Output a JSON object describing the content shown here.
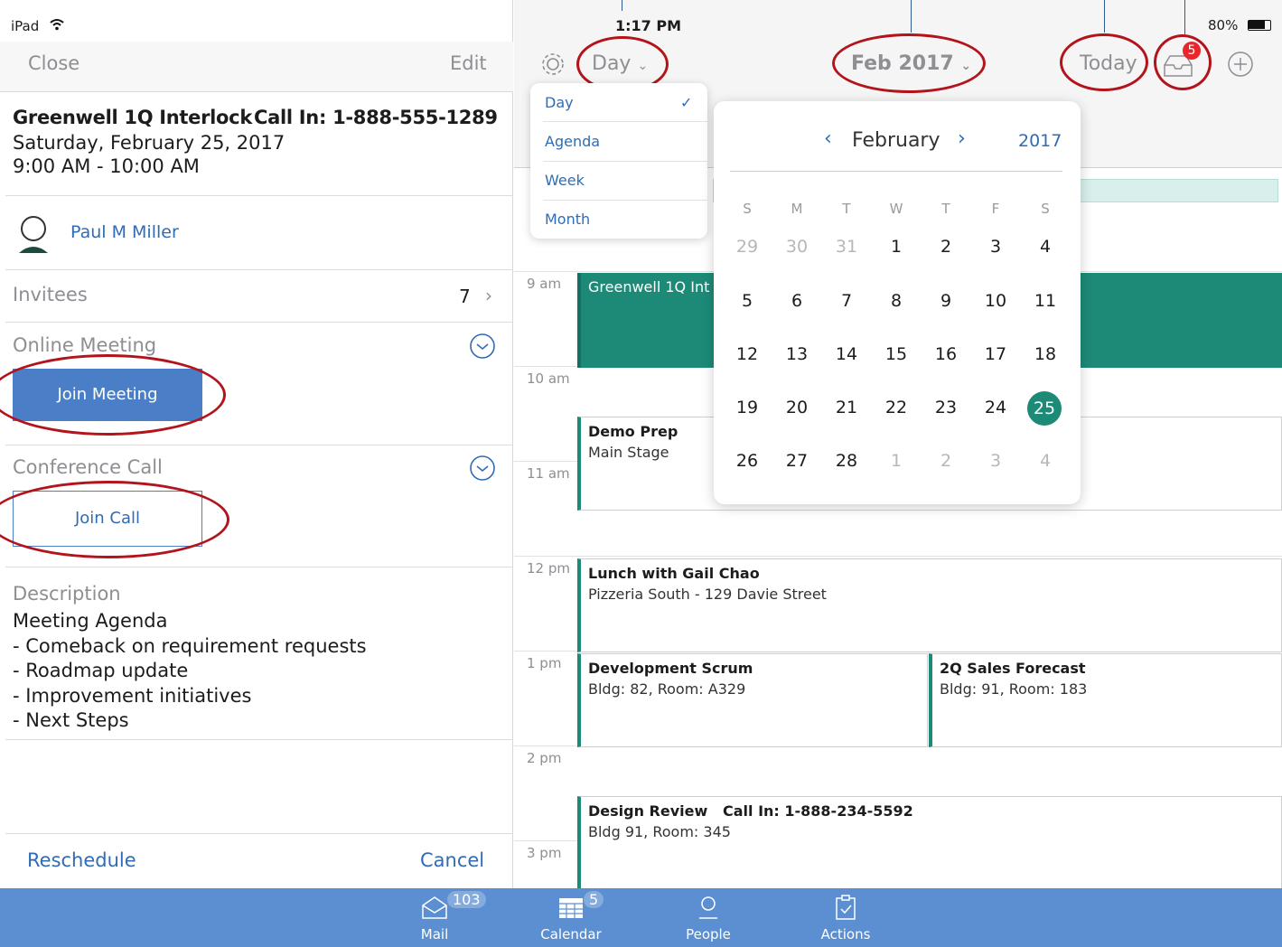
{
  "status": {
    "device": "iPad",
    "time": "1:17 PM",
    "battery": "80%"
  },
  "left": {
    "close": "Close",
    "edit": "Edit",
    "title": "Greenwell 1Q Interlock",
    "call_in": "Call In: 1-888-555-1289",
    "date": "Saturday, February 25, 2017",
    "time": "9:00 AM - 10:00 AM",
    "organizer": "Paul M Miller",
    "invitees_label": "Invitees",
    "invitees_count": "7",
    "online_meeting": "Online Meeting",
    "join_meeting": "Join Meeting",
    "conference_call": "Conference Call",
    "join_call": "Join Call",
    "description_label": "Description",
    "description": [
      "Meeting Agenda",
      "- Comeback on requirement requests",
      "- Roadmap update",
      "- Improvement initiatives",
      "- Next Steps"
    ],
    "reschedule": "Reschedule",
    "cancel": "Cancel"
  },
  "toolbar": {
    "view": "Day",
    "month_year": "Feb 2017",
    "today": "Today",
    "inbox_badge": "5"
  },
  "view_menu": {
    "items": [
      "Day",
      "Agenda",
      "Week",
      "Month"
    ],
    "selected": "Day"
  },
  "picker": {
    "month": "February",
    "year": "2017",
    "weekdays": [
      "S",
      "M",
      "T",
      "W",
      "T",
      "F",
      "S"
    ],
    "weeks": [
      [
        "29",
        "30",
        "31",
        "1",
        "2",
        "3",
        "4"
      ],
      [
        "5",
        "6",
        "7",
        "8",
        "9",
        "10",
        "11"
      ],
      [
        "12",
        "13",
        "14",
        "15",
        "16",
        "17",
        "18"
      ],
      [
        "19",
        "20",
        "21",
        "22",
        "23",
        "24",
        "25"
      ],
      [
        "26",
        "27",
        "28",
        "1",
        "2",
        "3",
        "4"
      ]
    ],
    "selected": "25",
    "accent": "#1d8a78"
  },
  "hours": [
    "9 am",
    "10 am",
    "11 am",
    "12 pm",
    "1 pm",
    "2 pm",
    "3 pm"
  ],
  "events": [
    {
      "title": "Greenwell 1Q Int",
      "sub": ""
    },
    {
      "title": "Demo Prep",
      "sub": "Main Stage"
    },
    {
      "title": "Lunch with Gail Chao",
      "sub": "Pizzeria South - 129 Davie Street"
    },
    {
      "title": "Development Scrum",
      "sub": "Bldg: 82, Room: A329"
    },
    {
      "title": "2Q Sales Forecast",
      "sub": "Bldg: 91, Room: 183"
    },
    {
      "title": "Design Review   Call In: 1-888-234-5592",
      "sub": "Bldg 91, Room: 345"
    }
  ],
  "tabs": [
    {
      "label": "Mail",
      "badge": "103",
      "icon": "mail-icon"
    },
    {
      "label": "Calendar",
      "badge": "5",
      "icon": "calendar-icon"
    },
    {
      "label": "People",
      "badge": "",
      "icon": "person-icon"
    },
    {
      "label": "Actions",
      "badge": "",
      "icon": "clipboard-icon"
    }
  ]
}
